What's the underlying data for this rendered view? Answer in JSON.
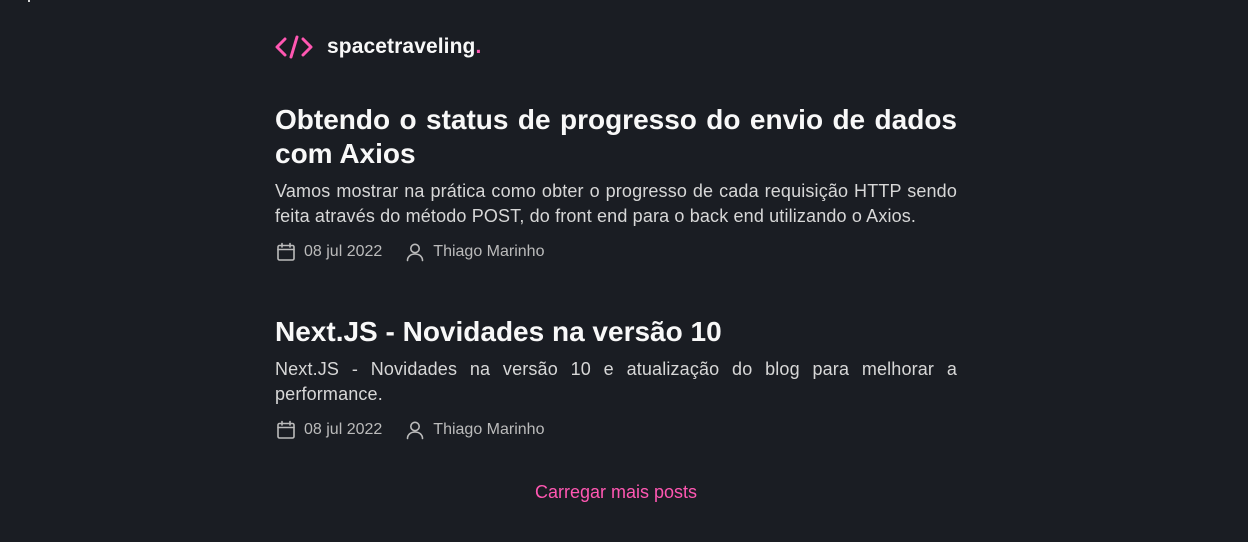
{
  "header": {
    "brand": "spacetraveling",
    "brand_dot": ".",
    "logo_icon": "code-brackets-icon",
    "accent_color": "#ff57b2"
  },
  "posts": [
    {
      "title": "Obtendo o status de progresso do envio de dados com Axios",
      "subtitle": "Vamos mostrar na prática como obter o progresso de cada requisição HTTP sendo feita através do método POST, do front end para o back end utilizando o Axios.",
      "date": "08 jul 2022",
      "author": "Thiago Marinho"
    },
    {
      "title": "Next.JS - Novidades na versão 10",
      "subtitle": "Next.JS - Novidades na versão 10 e atualização do blog para melhorar a performance.",
      "date": "08 jul 2022",
      "author": "Thiago Marinho"
    }
  ],
  "load_more": {
    "label": "Carregar mais posts"
  },
  "colors": {
    "background": "#1a1d23",
    "title": "#f8f8f8",
    "body": "#d7d7d7",
    "meta": "#bbbbbb",
    "accent": "#ff57b2"
  }
}
